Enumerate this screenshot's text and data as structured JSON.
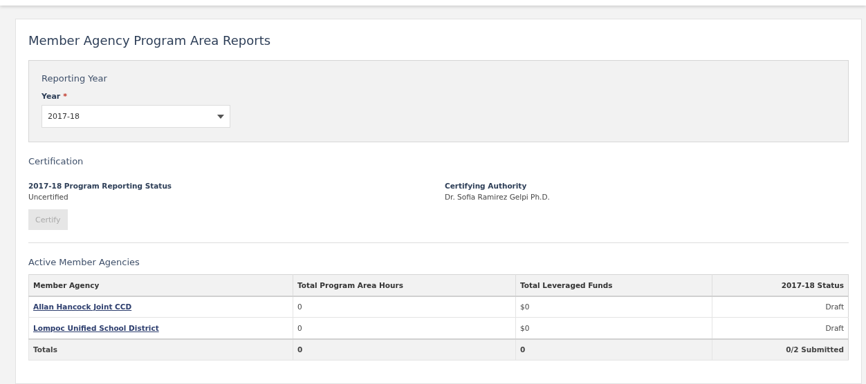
{
  "title": "Member Agency Program Area Reports",
  "reporting_year": {
    "heading": "Reporting Year",
    "label": "Year",
    "required_mark": "*",
    "value": "2017-18"
  },
  "certification": {
    "heading": "Certification",
    "fields": [
      {
        "label": "2017-18 Program Reporting Status",
        "value": "Uncertified"
      },
      {
        "label": "Certifying Authority",
        "value": "Dr. Sofia Ramirez Gelpi Ph.D."
      }
    ],
    "button": {
      "label": "Certify",
      "disabled": true
    }
  },
  "agencies": {
    "heading": "Active Member Agencies",
    "columns": [
      "Member Agency",
      "Total Program Area Hours",
      "Total Leveraged Funds",
      "2017-18 Status"
    ],
    "rows": [
      {
        "kind": "link",
        "cells": [
          "Allan Hancock Joint CCD",
          "0",
          "$0",
          "Draft"
        ]
      },
      {
        "kind": "link",
        "cells": [
          "Lompoc Unified School District",
          "0",
          "$0",
          "Draft"
        ]
      },
      {
        "kind": "total",
        "cells": [
          "Totals",
          "0",
          "0",
          "0/2 Submitted"
        ]
      }
    ]
  }
}
